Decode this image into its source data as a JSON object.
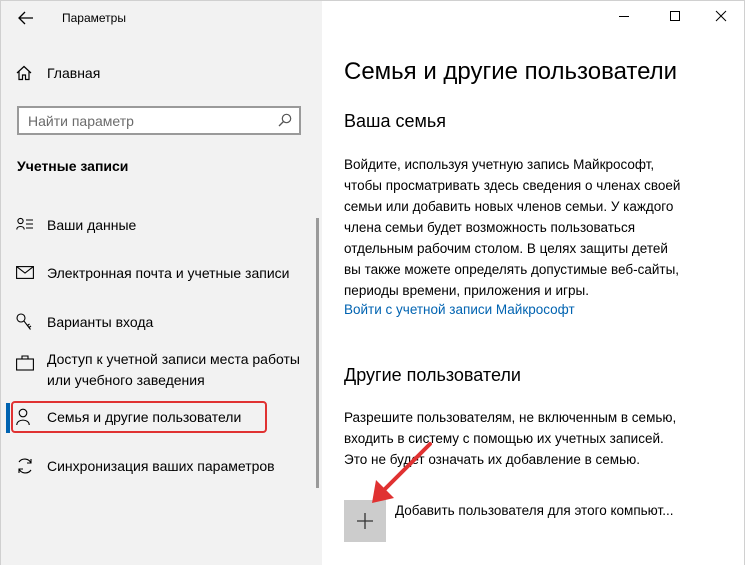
{
  "window": {
    "title": "Параметры",
    "back_icon": "back-arrow-icon",
    "controls": [
      "minimize-icon",
      "maximize-icon",
      "close-icon"
    ]
  },
  "sidebar": {
    "home_label": "Главная",
    "search_placeholder": "Найти параметр",
    "section_title": "Учетные записи",
    "items": [
      {
        "label": "Ваши данные",
        "icon": "person-card-icon"
      },
      {
        "label": "Электронная почта и учетные записи",
        "icon": "mail-icon"
      },
      {
        "label": "Варианты входа",
        "icon": "key-icon"
      },
      {
        "label": "Доступ к учетной записи места работы",
        "label2": "или учебного заведения",
        "icon": "briefcase-icon"
      },
      {
        "label": "Семья и другие пользователи",
        "icon": "person-add-icon",
        "selected": true
      },
      {
        "label": "Синхронизация ваших параметров",
        "icon": "sync-icon"
      }
    ]
  },
  "main": {
    "title": "Семья и другие пользователи",
    "family": {
      "heading": "Ваша семья",
      "lines": [
        "Войдите, используя учетную запись Майкрософт,",
        "чтобы просматривать здесь сведения о членах своей",
        "семьи или добавить новых членов семьи. У каждого",
        "члена семьи будет возможность пользоваться",
        "отдельным рабочим столом. В целях защиты детей",
        "вы также можете определять допустимые веб-сайты,",
        "периоды времени, приложения и игры."
      ],
      "link": "Войти с учетной записи Майкрософт"
    },
    "others": {
      "heading": "Другие пользователи",
      "lines": [
        "Разрешите пользователям, не включенным в семью,",
        "входить в систему с помощью их учетных записей.",
        "Это не будет означать их добавление в семью."
      ],
      "add_label": "Добавить пользователя для этого компьют..."
    }
  },
  "colors": {
    "accent": "#0063b1",
    "sidebar_bg": "#f2f2f2",
    "annotation_red": "#e03232",
    "add_button_bg": "#cccccc"
  }
}
